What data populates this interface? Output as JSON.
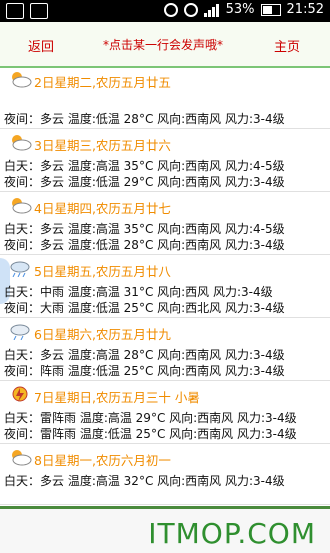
{
  "status_bar": {
    "battery": "53%",
    "time": "21:52"
  },
  "header": {
    "back": "返回",
    "hint": "*点击某一行会发声哦*",
    "home": "主页"
  },
  "days": [
    {
      "date": "2日星期二,农历五月廿五",
      "day_row": null,
      "night_row": "夜间：多云  温度:低温 28°C  风向:西南风  风力:3-4级",
      "icon": "cloudy-sun-icon"
    },
    {
      "date": "3日星期三,农历五月廿六",
      "day_row": "白天：多云  温度:高温 35°C  风向:西南风  风力:4-5级",
      "night_row": "夜间：多云  温度:低温 29°C  风向:西南风  风力:3-4级",
      "icon": "cloudy-sun-icon"
    },
    {
      "date": "4日星期四,农历五月廿七",
      "day_row": "白天：多云  温度:高温 35°C  风向:西南风  风力:4-5级",
      "night_row": "夜间：多云  温度:低温 28°C  风向:西南风  风力:3-4级",
      "icon": "cloudy-sun-icon"
    },
    {
      "date": "5日星期五,农历五月廿八",
      "day_row": "白天：中雨  温度:高温 31°C  风向:西风  风力:3-4级",
      "night_row": "夜间：大雨  温度:低温 25°C  风向:西北风  风力:3-4级",
      "icon": "rain-icon"
    },
    {
      "date": "6日星期六,农历五月廿九",
      "day_row": "白天：多云  温度:高温 28°C  风向:西南风  风力:3-4级",
      "night_row": "夜间：阵雨  温度:低温 25°C  风向:西南风  风力:3-4级",
      "icon": "rain-cloud-icon"
    },
    {
      "date": "7日星期日,农历五月三十 小暑",
      "day_row": "白天：雷阵雨  温度:高温 29°C  风向:西南风  风力:3-4级",
      "night_row": "夜间：雷阵雨  温度:低温 25°C  风向:西南风  风力:3-4级",
      "icon": "thunder-icon"
    },
    {
      "date": "8日星期一,农历六月初一",
      "day_row": "白天：多云  温度:高温 32°C  风向:西南风  风力:3-4级",
      "night_row": null,
      "icon": "cloudy-sun-icon"
    }
  ],
  "watermark": "ITMOP.COM"
}
